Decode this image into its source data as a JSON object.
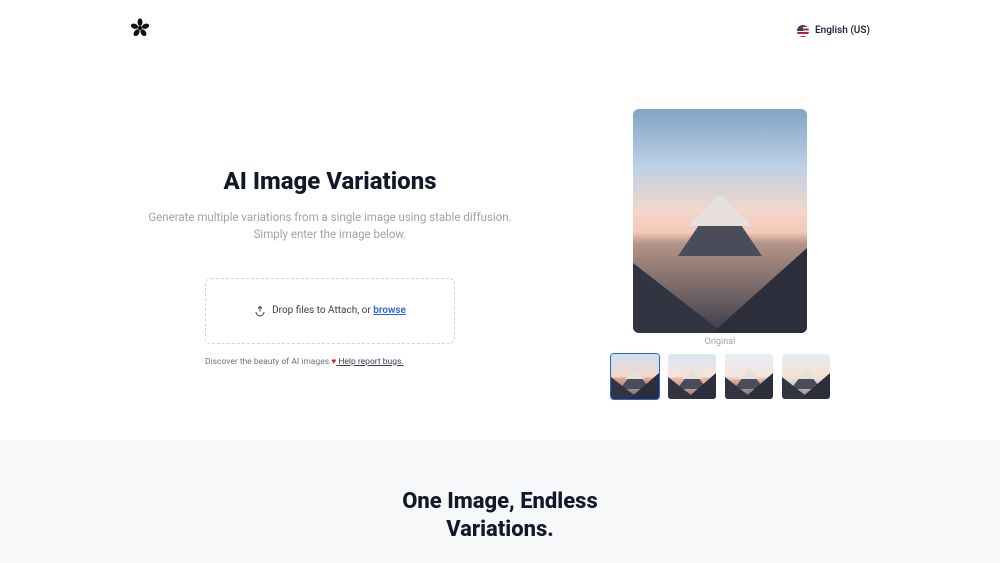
{
  "header": {
    "language_label": "English (US)"
  },
  "hero": {
    "title": "AI Image Variations",
    "subtitle_line1": "Generate multiple variations from a single image using stable diffusion.",
    "subtitle_line2": "Simply enter the image below.",
    "dropzone_prefix": "Drop files to Attach, or ",
    "dropzone_browse": "browse",
    "footnote_prefix": "Discover the beauty of AI images ",
    "footnote_heart": "♥",
    "footnote_link": " Help report bugs.",
    "preview_caption": "Original"
  },
  "section2": {
    "title": "One Image, Endless Variations."
  }
}
